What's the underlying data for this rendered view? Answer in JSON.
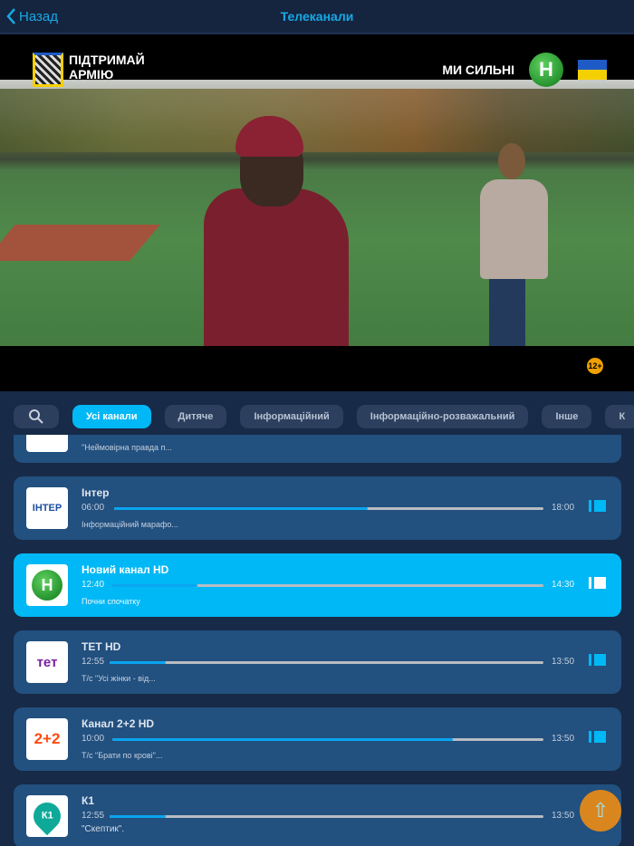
{
  "header": {
    "back_label": "Назад",
    "title": "Телеканали"
  },
  "video": {
    "overlay_left": [
      "ПІДТРИМАЙ",
      "АРМІЮ"
    ],
    "overlay_right": "МИ СИЛЬНІ",
    "channel_logo": "Н",
    "age_rating": "12+"
  },
  "filters": [
    "Усі канали",
    "Дитяче",
    "Інформаційний",
    "Інформаційно-розважальний",
    "Інше",
    "К"
  ],
  "channels": [
    {
      "name": "",
      "start": "",
      "end": "",
      "program": "\"Неймовірна правда п...",
      "progress": 0,
      "logo": ""
    },
    {
      "name": "Інтер",
      "start": "06:00",
      "end": "18:00",
      "program": "Інформаційний марафо...",
      "progress": 59,
      "logo": "ІНТЕР"
    },
    {
      "name": "Новий канал HD",
      "start": "12:40",
      "end": "14:30",
      "program": "Почни спочатку",
      "progress": 20,
      "logo": "Н",
      "selected": true
    },
    {
      "name": "ТЕТ HD",
      "start": "12:55",
      "end": "13:50",
      "program": "Т/с \"Усі жінки - від...",
      "progress": 13,
      "logo": "тет"
    },
    {
      "name": "Канал 2+2 HD",
      "start": "10:00",
      "end": "13:50",
      "program": "Т/с \"Брати по крові\"...",
      "progress": 79,
      "logo": "2+2"
    },
    {
      "name": "К1",
      "start": "12:55",
      "end": "13:50",
      "program": "\"Скептик\".",
      "progress": 13,
      "logo": "К1"
    }
  ],
  "colors": {
    "accent": "#00b8f5",
    "card": "#22507f",
    "bg": "#172a47",
    "fab": "#d9861f"
  }
}
